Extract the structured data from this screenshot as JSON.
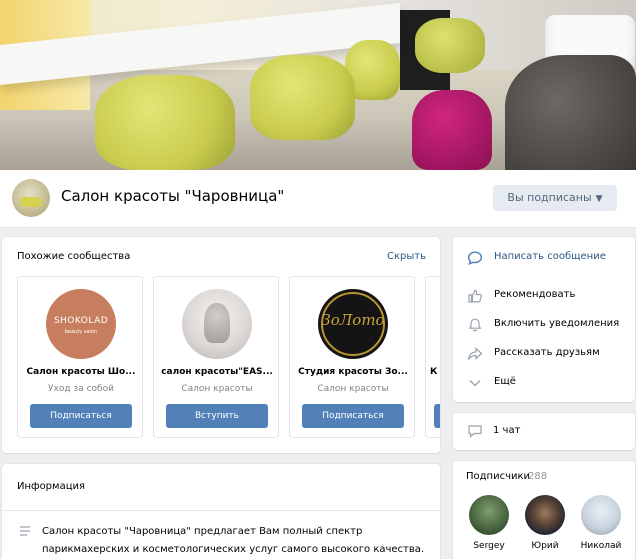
{
  "header": {
    "title": "Салон красоты \"Чаровница\"",
    "subscribed_button": "Вы подписаны"
  },
  "similar": {
    "title": "Похожие сообщества",
    "hide_link": "Скрыть",
    "cards": [
      {
        "name": "Салон красоты Шо...",
        "subtitle": "Уход за собой",
        "button": "Подписаться",
        "avatar_text": "SHOKOLAD",
        "avatar_subtext": "beauty salon"
      },
      {
        "name": "салон красоты\"EAS...",
        "subtitle": "Салон красоты",
        "button": "Вступить"
      },
      {
        "name": "Студия красоты Зо...",
        "subtitle": "Салон красоты",
        "button": "Подписаться",
        "avatar_text": "ЗоЛото"
      },
      {
        "name": "К",
        "subtitle": "",
        "button": ""
      }
    ]
  },
  "actions": {
    "items": [
      {
        "label": "Написать сообщение",
        "icon": "message-icon"
      },
      {
        "label": "Рекомендовать",
        "icon": "thumbs-up-icon"
      },
      {
        "label": "Включить уведомления",
        "icon": "bell-icon"
      },
      {
        "label": "Рассказать друзьям",
        "icon": "share-icon"
      },
      {
        "label": "Ещё",
        "icon": "chevron-down-icon"
      }
    ]
  },
  "chat": {
    "label": "1 чат"
  },
  "info": {
    "title": "Информация",
    "text": "Салон красоты \"Чаровница\" предлагает Вам полный спектр парикмахерских и косметологических услуг самого высокого качества. Профессиональные"
  },
  "subscribers": {
    "title": "Подписчики",
    "count": "288",
    "members": [
      {
        "name": "Sergey"
      },
      {
        "name": "Юрий"
      },
      {
        "name": "Николай"
      }
    ]
  },
  "colors": {
    "accent": "#5181b8",
    "link": "#2a5885",
    "background": "#edeef0"
  }
}
